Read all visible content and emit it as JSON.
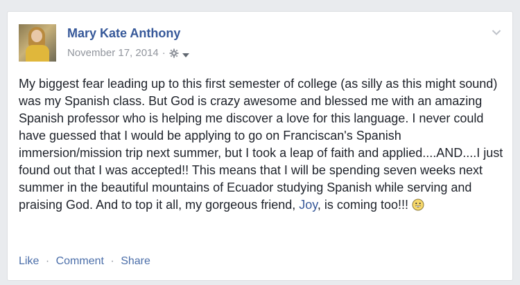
{
  "post": {
    "author": "Mary Kate Anthony",
    "date": "November 17, 2014",
    "separator": "·",
    "privacy_icon": "gear-icon",
    "menu_icon": "chevron-down-icon",
    "text_part1": "My biggest fear leading up to this first semester of college (as silly as this might sound) was my Spanish class. But God is crazy awesome and blessed me with an amazing Spanish professor who is helping me discover a love for this language. I never could have guessed that I would be applying to go on Franciscan's Spanish immersion/mission trip next summer, but I took a leap of faith and applied....AND....I just found out that I was accepted!! This means that I will be spending seven weeks next summer in the beautiful mountains of Ecuador studying Spanish while serving and praising God. And to top it all, my gorgeous friend, ",
    "mention": "Joy",
    "text_part2": ", is coming too!!! ",
    "emoji": "smiley-emoji"
  },
  "actions": {
    "like": "Like",
    "comment": "Comment",
    "share": "Share",
    "separator": "·"
  },
  "colors": {
    "link": "#365899",
    "muted": "#90949c",
    "text": "#1d2129",
    "action": "#4b6ea9"
  }
}
